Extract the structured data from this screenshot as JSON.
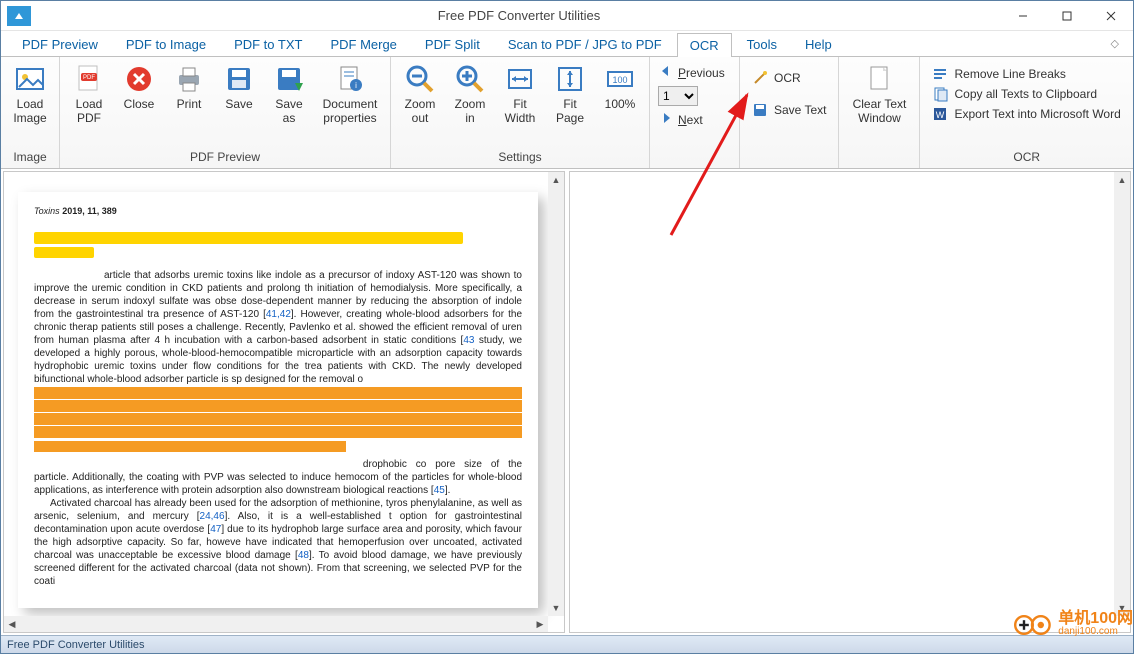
{
  "window": {
    "title": "Free PDF Converter Utilities"
  },
  "tabs": {
    "pdf_preview": "PDF Preview",
    "pdf_to_image": "PDF to Image",
    "pdf_to_txt": "PDF to TXT",
    "pdf_merge": "PDF Merge",
    "pdf_split": "PDF Split",
    "scan": "Scan to PDF / JPG to PDF",
    "ocr": "OCR",
    "tools": "Tools",
    "help": "Help"
  },
  "ribbon": {
    "image_group": {
      "title": "Image",
      "load_image": "Load\nImage"
    },
    "pdf_preview_group": {
      "title": "PDF Preview",
      "load_pdf": "Load\nPDF",
      "close": "Close",
      "print": "Print",
      "save": "Save",
      "save_as": "Save\nas",
      "doc_props": "Document\nproperties"
    },
    "settings_group": {
      "title": "Settings",
      "zoom_out": "Zoom\nout",
      "zoom_in": "Zoom\nin",
      "fit_width": "Fit\nWidth",
      "fit_page": "Fit\nPage",
      "hundred": "100%"
    },
    "nav_group": {
      "previous": "Previous",
      "next": "Next",
      "page_value": "1"
    },
    "ocr_actions": {
      "ocr": "OCR",
      "save_text": "Save Text"
    },
    "clear_text": "Clear Text\nWindow",
    "ocr_group": {
      "title": "OCR",
      "remove_breaks": "Remove Line Breaks",
      "copy_clipboard": "Copy all Texts to Clipboard",
      "export_word": "Export Text into Microsoft Word"
    }
  },
  "document": {
    "journal": "Toxins",
    "year_vol": "2019, 11, 389",
    "body_lines": [
      "article that adsorbs uremic toxins like indole as a precursor of indoxy",
      "AST-120 was shown to improve the uremic condition in CKD patients and prolong th",
      "initiation of hemodialysis. More specifically, a decrease in serum indoxyl sulfate was obse",
      "dose-dependent manner by reducing the absorption of indole from the gastrointestinal tra",
      "presence of AST-120 [",
      "].  However, creating whole-blood adsorbers for the chronic therap",
      "patients still poses a challenge. Recently, Pavlenko et al. showed the efficient removal of uren",
      "from human plasma after 4 h incubation with a carbon-based adsorbent in static conditions [",
      "study, we developed a highly porous, whole-blood-hemocompatible microparticle with an",
      "adsorption capacity towards hydrophobic uremic toxins under flow conditions for the trea",
      "patients with CKD. The newly developed bifunctional whole-blood adsorber particle is sp",
      "designed for the removal o",
      "drophobic co",
      "pore size of the particle.  Additionally, the coating with PVP was selected to induce hemocom",
      "of the particles for whole-blood applications, as interference with protein adsorption also",
      "downstream biological reactions [",
      "Activated charcoal has already been used for the adsorption of methionine, tyros",
      "phenylalanine, as well as arsenic, selenium, and mercury [",
      "]. Also, it is a well-established t",
      "option for gastrointestinal decontamination upon acute overdose [",
      "] due to its hydrophob",
      "large surface area and porosity, which favour the high adsorptive capacity. So far, howeve",
      "have indicated that hemoperfusion over uncoated, activated charcoal was unacceptable be",
      "excessive blood damage [",
      "]. To avoid blood damage, we have previously screened different",
      "for the activated charcoal (data not shown).  From that screening, we selected PVP for the coati"
    ],
    "refs": {
      "r4142": "41,42",
      "r43": "43",
      "r45": "45",
      "r2446": "24,46",
      "r47": "47",
      "r48": "48"
    }
  },
  "statusbar": {
    "text": "Free PDF Converter Utilities"
  },
  "watermark": {
    "brand": "单机100网",
    "url": "danji100.com"
  }
}
